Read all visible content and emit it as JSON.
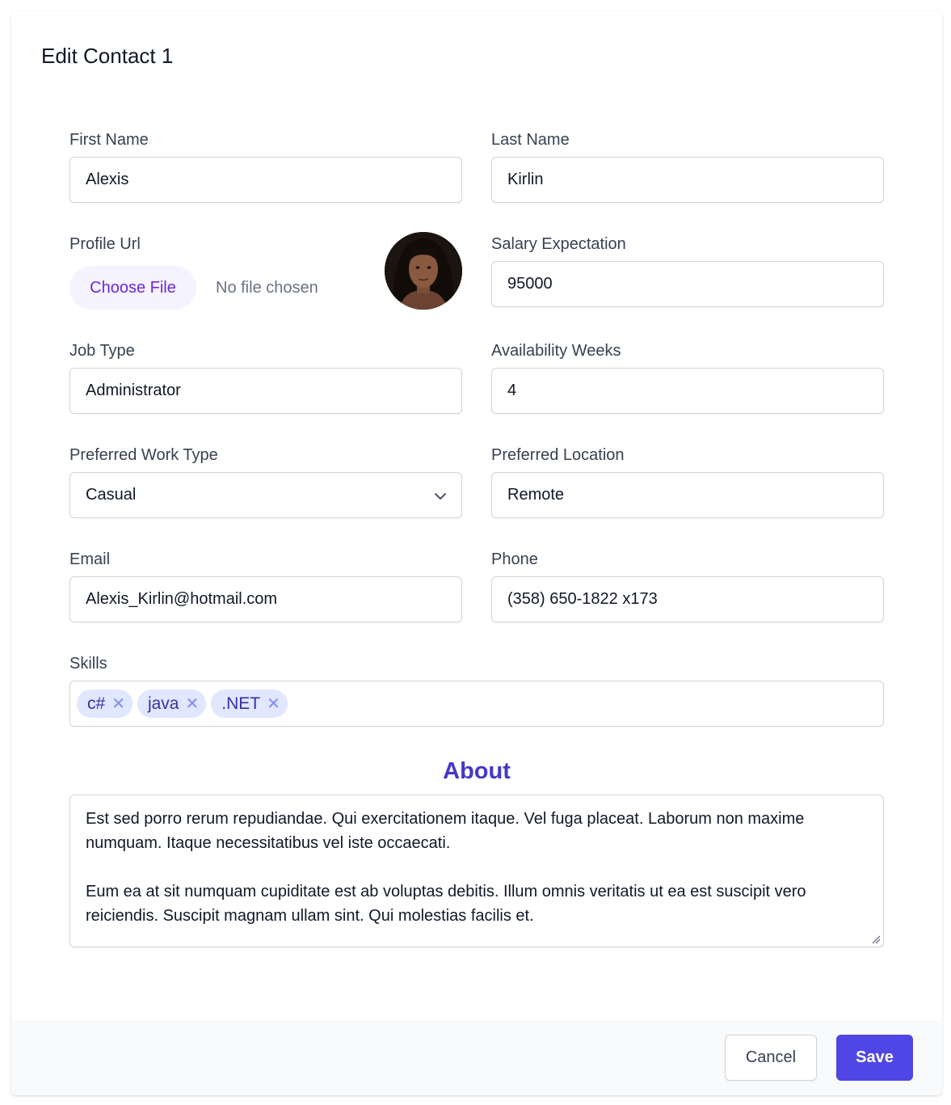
{
  "dialog": {
    "title": "Edit Contact 1"
  },
  "form": {
    "first_name": {
      "label": "First Name",
      "value": "Alexis"
    },
    "last_name": {
      "label": "Last Name",
      "value": "Kirlin"
    },
    "profile_url": {
      "label": "Profile Url",
      "button_label": "Choose File",
      "status": "No file chosen"
    },
    "salary_expectation": {
      "label": "Salary Expectation",
      "value": "95000"
    },
    "job_type": {
      "label": "Job Type",
      "value": "Administrator"
    },
    "availability_weeks": {
      "label": "Availability Weeks",
      "value": "4"
    },
    "preferred_work_type": {
      "label": "Preferred Work Type",
      "value": "Casual",
      "icon": "chevron-down-icon"
    },
    "preferred_location": {
      "label": "Preferred Location",
      "value": "Remote"
    },
    "email": {
      "label": "Email",
      "value": "Alexis_Kirlin@hotmail.com"
    },
    "phone": {
      "label": "Phone",
      "value": "(358) 650-1822 x173"
    },
    "skills": {
      "label": "Skills",
      "items": [
        "c#",
        "java",
        ".NET"
      ],
      "remove_glyph": "✕"
    },
    "about": {
      "heading": "About",
      "text": "Est sed porro rerum repudiandae. Qui exercitationem itaque. Vel fuga placeat. Laborum non maxime numquam. Itaque necessitatibus vel iste occaecati.\n\nEum ea at sit numquam cupiditate est ab voluptas debitis. Illum omnis veritatis ut ea est suscipit vero reiciendis. Suscipit magnam ullam sint. Qui molestias facilis et."
    }
  },
  "footer": {
    "cancel_label": "Cancel",
    "save_label": "Save"
  },
  "colors": {
    "accent": "#4f46e5",
    "chip_bg": "#e0e7ff",
    "chip_text": "#3730a3",
    "about_heading": "#4338ca",
    "file_button_bg": "#f5f3ff",
    "file_button_text": "#6d28d9"
  }
}
